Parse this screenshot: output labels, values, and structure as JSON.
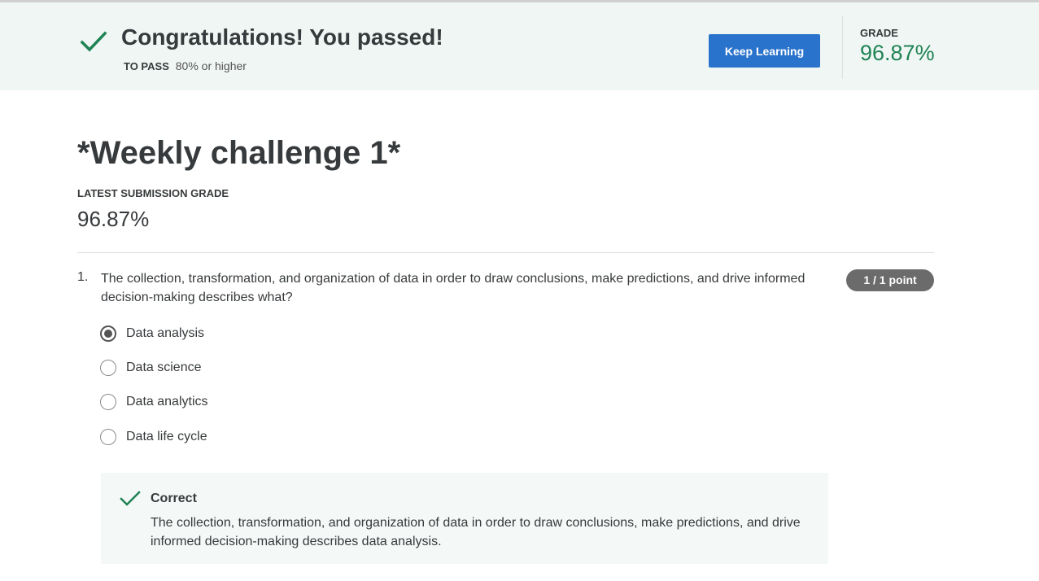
{
  "banner": {
    "title": "Congratulations! You passed!",
    "to_pass_label": "TO PASS",
    "to_pass_value": "80% or higher",
    "keep_learning_label": "Keep Learning",
    "grade_label": "GRADE",
    "grade_value": "96.87%",
    "check_icon": "check-icon"
  },
  "assignment": {
    "title": "*Weekly challenge 1*",
    "latest_grade_label": "LATEST SUBMISSION GRADE",
    "latest_grade_value": "96.87%"
  },
  "questions": [
    {
      "number": "1.",
      "text": "The collection, transformation, and organization of data in order to draw conclusions, make predictions, and drive informed decision-making describes what?",
      "points": "1 / 1 point",
      "options": [
        {
          "label": "Data analysis",
          "selected": true
        },
        {
          "label": "Data science",
          "selected": false
        },
        {
          "label": "Data analytics",
          "selected": false
        },
        {
          "label": "Data life cycle",
          "selected": false
        }
      ],
      "feedback": {
        "title": "Correct",
        "text": "The collection, transformation, and organization of data in order to draw conclusions, make predictions, and drive informed decision-making describes data analysis."
      }
    }
  ],
  "colors": {
    "success_green": "#1f8354",
    "button_blue": "#2a73cc",
    "banner_bg": "#f0f6f4",
    "badge_gray": "#6b6b6b"
  }
}
